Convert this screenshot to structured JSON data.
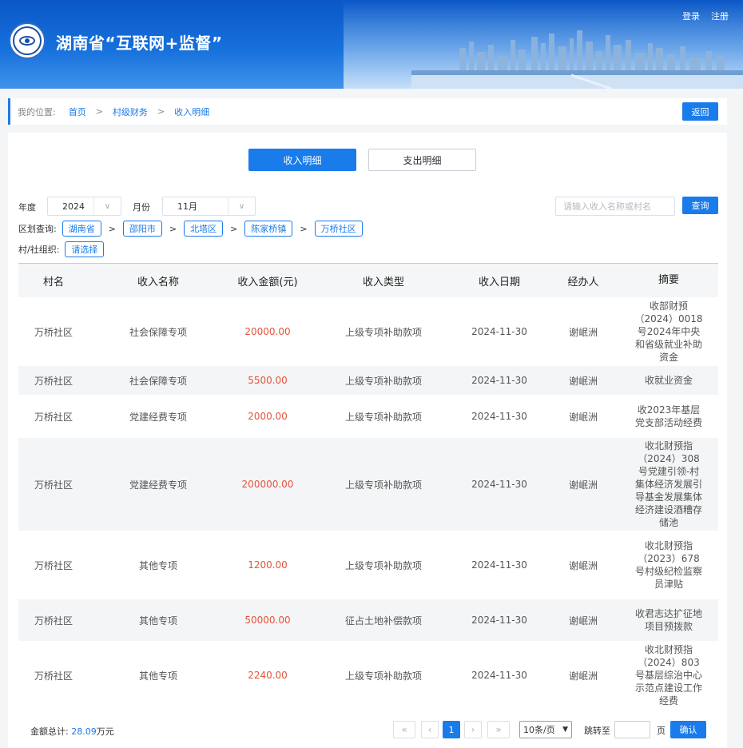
{
  "header": {
    "title": "湖南省“互联网+监督”",
    "login": "登录",
    "register": "注册",
    "logo_icon": "eye-emblem-icon"
  },
  "breadcrumb": {
    "label": "我的位置:",
    "items": [
      "首页",
      "村级财务",
      "收入明细"
    ],
    "separator": ">",
    "back": "返回"
  },
  "tabs": {
    "income": "收入明细",
    "expense": "支出明细"
  },
  "filters": {
    "year_label": "年度",
    "year_value": "2024",
    "month_label": "月份",
    "month_value": "11月",
    "search_placeholder": "请输入收入名称或村名",
    "query": "查询",
    "region_label": "区划查询:",
    "regions": [
      "湖南省",
      "邵阳市",
      "北塔区",
      "陈家桥镇",
      "万桥社区"
    ],
    "region_separator": ">",
    "org_label": "村/社组织:",
    "org_select": "请选择"
  },
  "table": {
    "headers": [
      "村名",
      "收入名称",
      "收入金额(元)",
      "收入类型",
      "收入日期",
      "经办人",
      "摘要"
    ],
    "rows": [
      [
        "万桥社区",
        "社会保障专项",
        "20000.00",
        "上级专项补助款项",
        "2024-11-30",
        "谢岷洲",
        "收部财预（2024）0018号2024年中央和省级就业补助资金"
      ],
      [
        "万桥社区",
        "社会保障专项",
        "5500.00",
        "上级专项补助款项",
        "2024-11-30",
        "谢岷洲",
        "收就业资金"
      ],
      [
        "万桥社区",
        "党建经费专项",
        "2000.00",
        "上级专项补助款项",
        "2024-11-30",
        "谢岷洲",
        "收2023年基层党支部活动经费"
      ],
      [
        "万桥社区",
        "党建经费专项",
        "200000.00",
        "上级专项补助款项",
        "2024-11-30",
        "谢岷洲",
        "收北财预指（2024）308号党建引领-村集体经济发展引导基金发展集体经济建设酒糟存储池"
      ],
      [
        "万桥社区",
        "其他专项",
        "1200.00",
        "上级专项补助款项",
        "2024-11-30",
        "谢岷洲",
        "收北财预指（2023）678号村级纪检监察员津贴"
      ],
      [
        "万桥社区",
        "其他专项",
        "50000.00",
        "征占土地补偿款项",
        "2024-11-30",
        "谢岷洲",
        "收君志达扩征地项目预拨款"
      ],
      [
        "万桥社区",
        "其他专项",
        "2240.00",
        "上级专项补助款项",
        "2024-11-30",
        "谢岷洲",
        "收北财预指（2024）803号基层综治中心示范点建设工作经费"
      ]
    ]
  },
  "footer": {
    "total_label": "金额总计:",
    "total_value": "28.09",
    "total_unit": "万元",
    "first": "«",
    "prev": "‹",
    "current_page": "1",
    "next": "›",
    "last": "»",
    "per_page": "10条/页",
    "goto_label": "跳转至",
    "page_unit": "页",
    "confirm": "确认"
  },
  "colors": {
    "accent": "#1a7bea",
    "amount": "#e5533c",
    "header_bg": "#1670dc"
  }
}
